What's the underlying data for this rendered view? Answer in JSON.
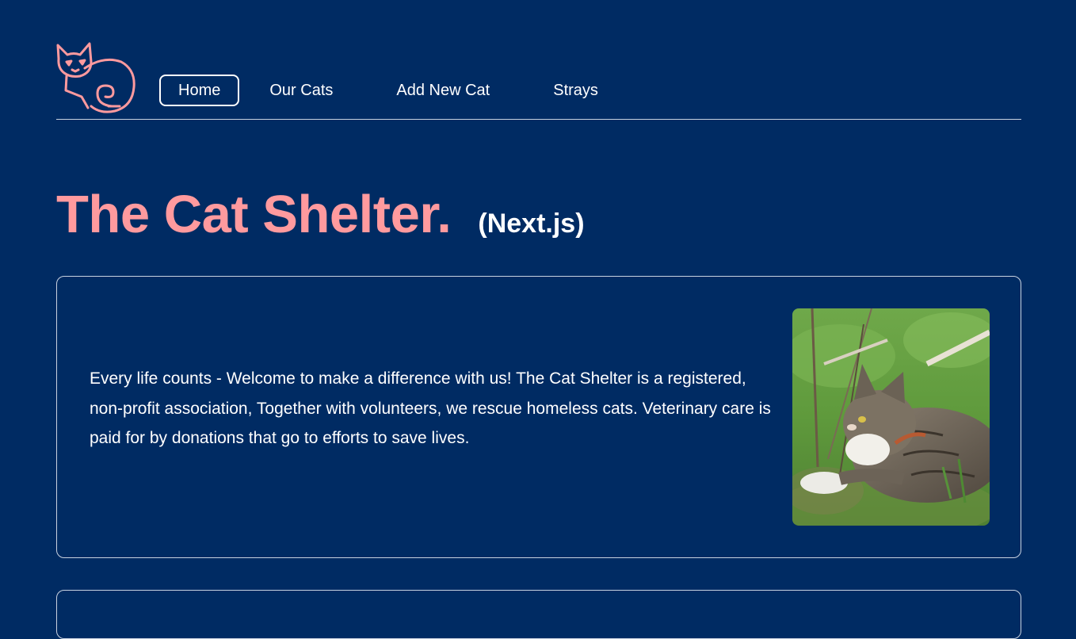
{
  "nav": {
    "items": [
      {
        "label": "Home",
        "active": true
      },
      {
        "label": "Our Cats",
        "active": false
      },
      {
        "label": "Add New Cat",
        "active": false
      },
      {
        "label": "Strays",
        "active": false
      }
    ]
  },
  "hero": {
    "title": "The Cat Shelter.",
    "subtitle": "(Next.js)"
  },
  "intro_card": {
    "text": "Every life counts - Welcome to make a difference with us! The Cat Shelter is a registered, non-profit association, Together with volunteers, we rescue homeless cats. Veterinary care is paid for by donations that go to efforts to save lives."
  },
  "colors": {
    "background": "#002b63",
    "accent": "#ff9a9e",
    "text": "#ffffff",
    "border": "#c9d2e0"
  },
  "icons": {
    "logo": "cat-logo-icon"
  }
}
